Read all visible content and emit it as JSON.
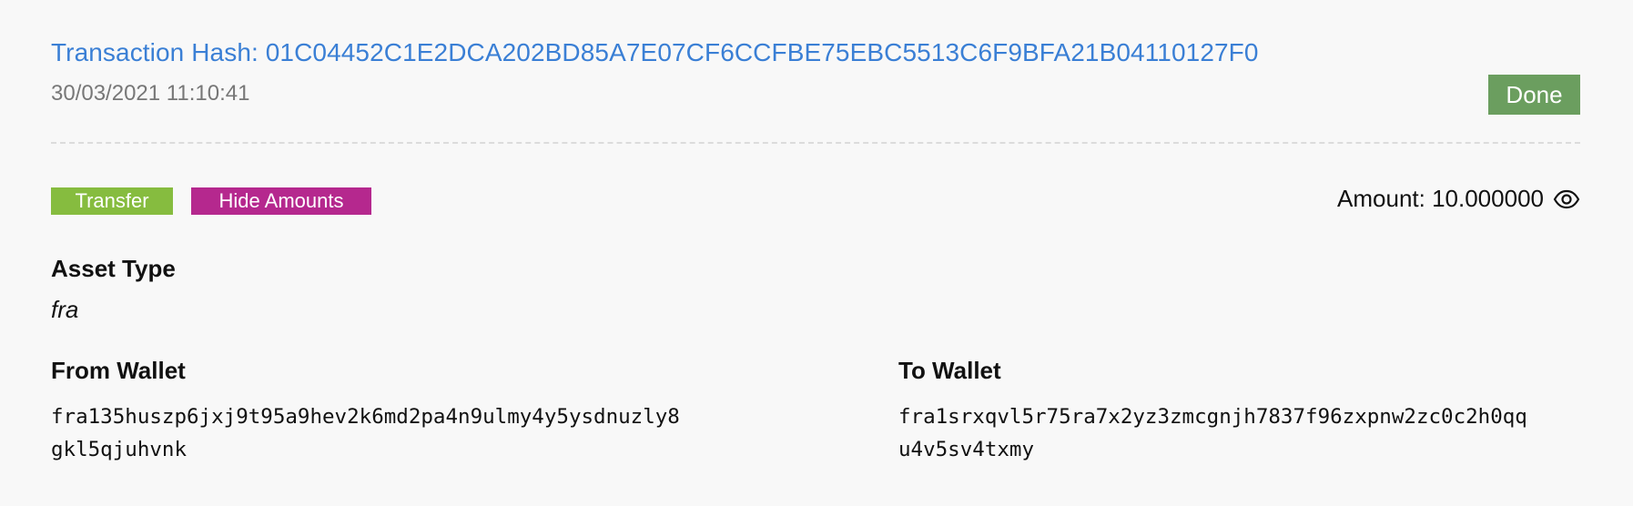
{
  "header": {
    "hash_label": "Transaction Hash: 01C04452C1E2DCA202BD85A7E07CF6CCFBE75EBC5513C6F9BFA21B04110127F0",
    "timestamp": "30/03/2021 11:10:41",
    "status": "Done"
  },
  "tags": {
    "transfer": "Transfer",
    "hide_amounts": "Hide Amounts"
  },
  "amount": {
    "text": "Amount: 10.000000",
    "icon": "eye-icon"
  },
  "asset": {
    "label": "Asset Type",
    "value": "fra"
  },
  "from_wallet": {
    "label": "From Wallet",
    "address_line1": "fra135huszp6jxj9t95a9hev2k6md2pa4n9ulmy4y5ysdnuzly8",
    "address_line2": "gkl5qjuhvnk"
  },
  "to_wallet": {
    "label": "To Wallet",
    "address_line1": "fra1srxqvl5r75ra7x2yz3zmcgnjh7837f96zxpnw2zc0c2h0qq",
    "address_line2": "u4v5sv4txmy"
  },
  "colors": {
    "link": "#3a7fd5",
    "done": "#6b9e5f",
    "transfer": "#86bc3f",
    "hide_amounts": "#b5288e"
  }
}
